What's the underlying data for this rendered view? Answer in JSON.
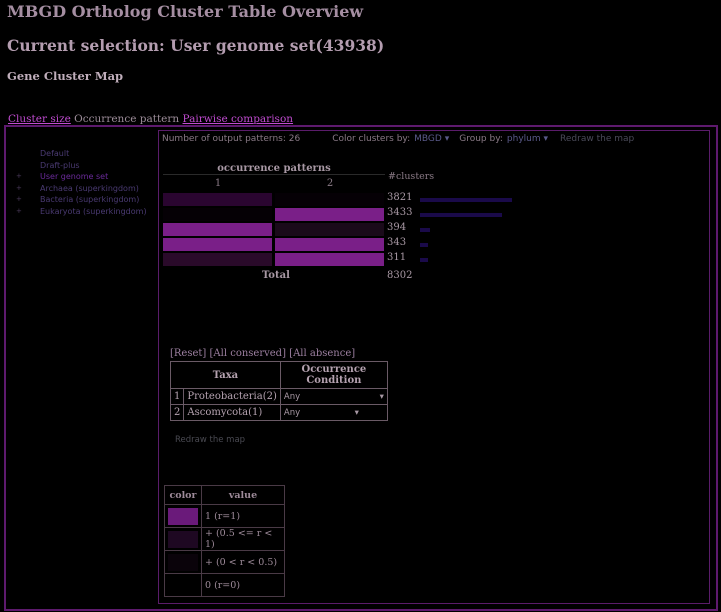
{
  "page": {
    "title": "MBGD Ortholog Cluster Table Overview",
    "selection": "Current selection: User genome set(43938)",
    "section": "Gene Cluster Map"
  },
  "tabs": {
    "cluster_size": "Cluster size",
    "occurrence": "Occurrence pattern",
    "pairwise": "Pairwise comparison"
  },
  "sidebar": {
    "items": [
      {
        "label": "Default"
      },
      {
        "label": "Draft-plus"
      },
      {
        "label": "User genome set"
      },
      {
        "label": "Archaea (superkingdom)"
      },
      {
        "label": "Bacteria (superkingdom)"
      },
      {
        "label": "Eukaryota (superkingdom)"
      }
    ]
  },
  "toolbar": {
    "output_patterns": "Number of output patterns: 26",
    "color_by_label": "Color clusters by:",
    "color_by_value": "MBGD",
    "group_by_label": "Group by:",
    "group_by_value": "phylum",
    "redraw": "Redraw the map"
  },
  "table": {
    "header": "occurrence patterns",
    "col1": "1",
    "col2": "2",
    "nclusters_label": "#clusters",
    "rows": [
      {
        "c1": "#2a0530",
        "c2": "#050005",
        "count": "3821",
        "fraction": 0.46
      },
      {
        "c1": "#050005",
        "c2": "#7a1f88",
        "count": "3433",
        "fraction": 0.41
      },
      {
        "c1": "#7a1f88",
        "c2": "#1a0a1a",
        "count": "394",
        "fraction": 0.05
      },
      {
        "c1": "#7a1f88",
        "c2": "#7a1f88",
        "count": "343",
        "fraction": 0.04
      },
      {
        "c1": "#2a0a2a",
        "c2": "#7a1f88",
        "count": "311",
        "fraction": 0.04
      }
    ],
    "total_label": "Total",
    "total_count": "8302"
  },
  "controls": {
    "reset": "[Reset]",
    "all_conserved": "[All conserved]",
    "all_absence": "[All absence]",
    "taxa_header": "Taxa",
    "occ_header": "Occurrence Condition",
    "taxa": [
      {
        "n": "1",
        "name": "Proteobacteria(2)",
        "cond": "Any"
      },
      {
        "n": "2",
        "name": "Ascomycota(1)",
        "cond": "Any"
      }
    ],
    "redraw": "Redraw the map"
  },
  "legend": {
    "color_header": "color",
    "value_header": "value",
    "rows": [
      {
        "color": "#6a1a7a",
        "value": "1 (r=1)"
      },
      {
        "color": "#1e0822",
        "value": "+ (0.5 <= r < 1)"
      },
      {
        "color": "#0a030a",
        "value": "+ (0 < r < 0.5)"
      },
      {
        "color": "#000000",
        "value": "0 (r=0)"
      }
    ]
  }
}
